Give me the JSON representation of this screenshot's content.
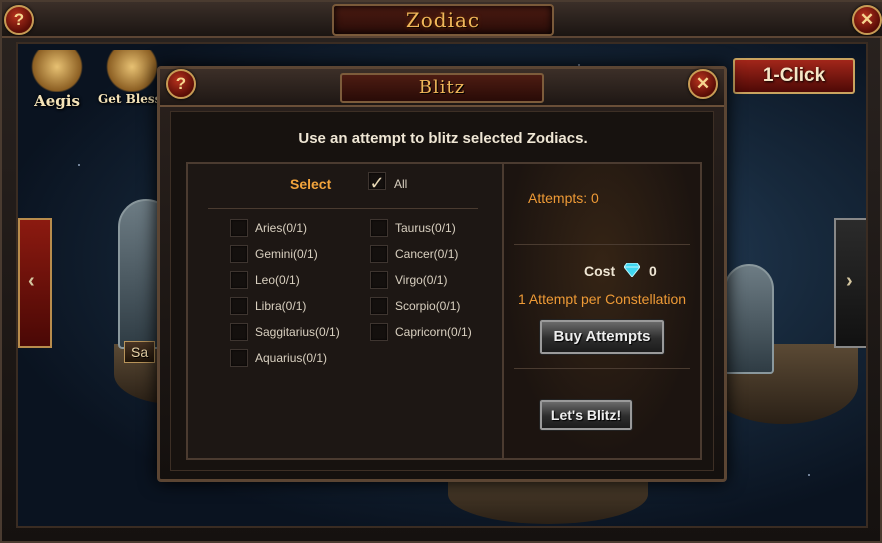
{
  "window": {
    "title": "Zodiac",
    "help_glyph": "?",
    "close_glyph": "✕"
  },
  "scene": {
    "aegis_label": "Aegis",
    "get_blessing_label": "Get Blessi",
    "one_click_label": "1-Click",
    "left_arrow_glyph": "‹",
    "right_arrow_glyph": "›",
    "tab_under_title": "Zodiac",
    "chip_left": "Sa"
  },
  "modal": {
    "title": "Blitz",
    "help_glyph": "?",
    "close_glyph": "✕",
    "instruction": "Use an attempt to blitz selected Zodiacs.",
    "select_label": "Select",
    "all_label": "All",
    "all_checked": true,
    "zodiacs": [
      {
        "label": "Aries(0/1)",
        "checked": false
      },
      {
        "label": "Taurus(0/1)",
        "checked": false
      },
      {
        "label": "Gemini(0/1)",
        "checked": false
      },
      {
        "label": "Cancer(0/1)",
        "checked": false
      },
      {
        "label": "Leo(0/1)",
        "checked": false
      },
      {
        "label": "Virgo(0/1)",
        "checked": false
      },
      {
        "label": "Libra(0/1)",
        "checked": false
      },
      {
        "label": "Scorpio(0/1)",
        "checked": false
      },
      {
        "label": "Saggitarius(0/1)",
        "checked": false
      },
      {
        "label": "Capricorn(0/1)",
        "checked": false
      },
      {
        "label": "Aquarius(0/1)",
        "checked": false
      }
    ],
    "attempts_text": "Attempts: 0",
    "cost_label": "Cost",
    "cost_value": "0",
    "cost_icon": "diamond-icon",
    "rate_text": "1 Attempt per Constellation",
    "buy_button": "Buy Attempts",
    "blitz_button": "Let's Blitz!"
  },
  "colors": {
    "title_gold": "#f0b75a",
    "accent_orange": "#ee9a36",
    "select_orange": "#f2a43c",
    "button_red": "#a2261a",
    "diamond": "#3fd7f0"
  }
}
